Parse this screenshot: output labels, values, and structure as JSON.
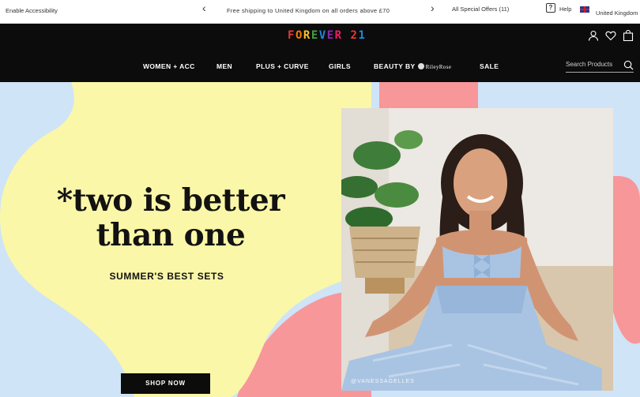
{
  "topbar": {
    "accessibility": "Enable Accessibility",
    "prev_icon": "chevron-left-icon",
    "promo": "Free shipping to United Kingdom on all orders above £70",
    "next_icon": "chevron-right-icon",
    "offers": "All Special Offers (11)",
    "help": "Help",
    "country": "United Kingdom"
  },
  "header": {
    "logo_letters": [
      "F",
      "O",
      "R",
      "E",
      "V",
      "E",
      "R",
      " ",
      "2",
      "1"
    ],
    "icons": [
      "account-icon",
      "wishlist-heart-icon",
      "shopping-bag-icon"
    ],
    "nav": {
      "women": "WOMEN + ACC",
      "men": "MEN",
      "plus": "PLUS + CURVE",
      "girls": "GIRLS",
      "beauty": "BEAUTY BY",
      "beauty_brand": "RileyRose",
      "sale": "SALE"
    },
    "search_placeholder": "Search Products"
  },
  "hero": {
    "headline_line1": "*two is better",
    "headline_line2": "than one",
    "subheading": "SUMMER'S BEST SETS",
    "cta": "SHOP NOW",
    "photo_credit": "@VANESSAGELLES",
    "colors": {
      "blue": "#cfe4f7",
      "yellow": "#fbf7a8",
      "pink": "#f7979a"
    }
  }
}
